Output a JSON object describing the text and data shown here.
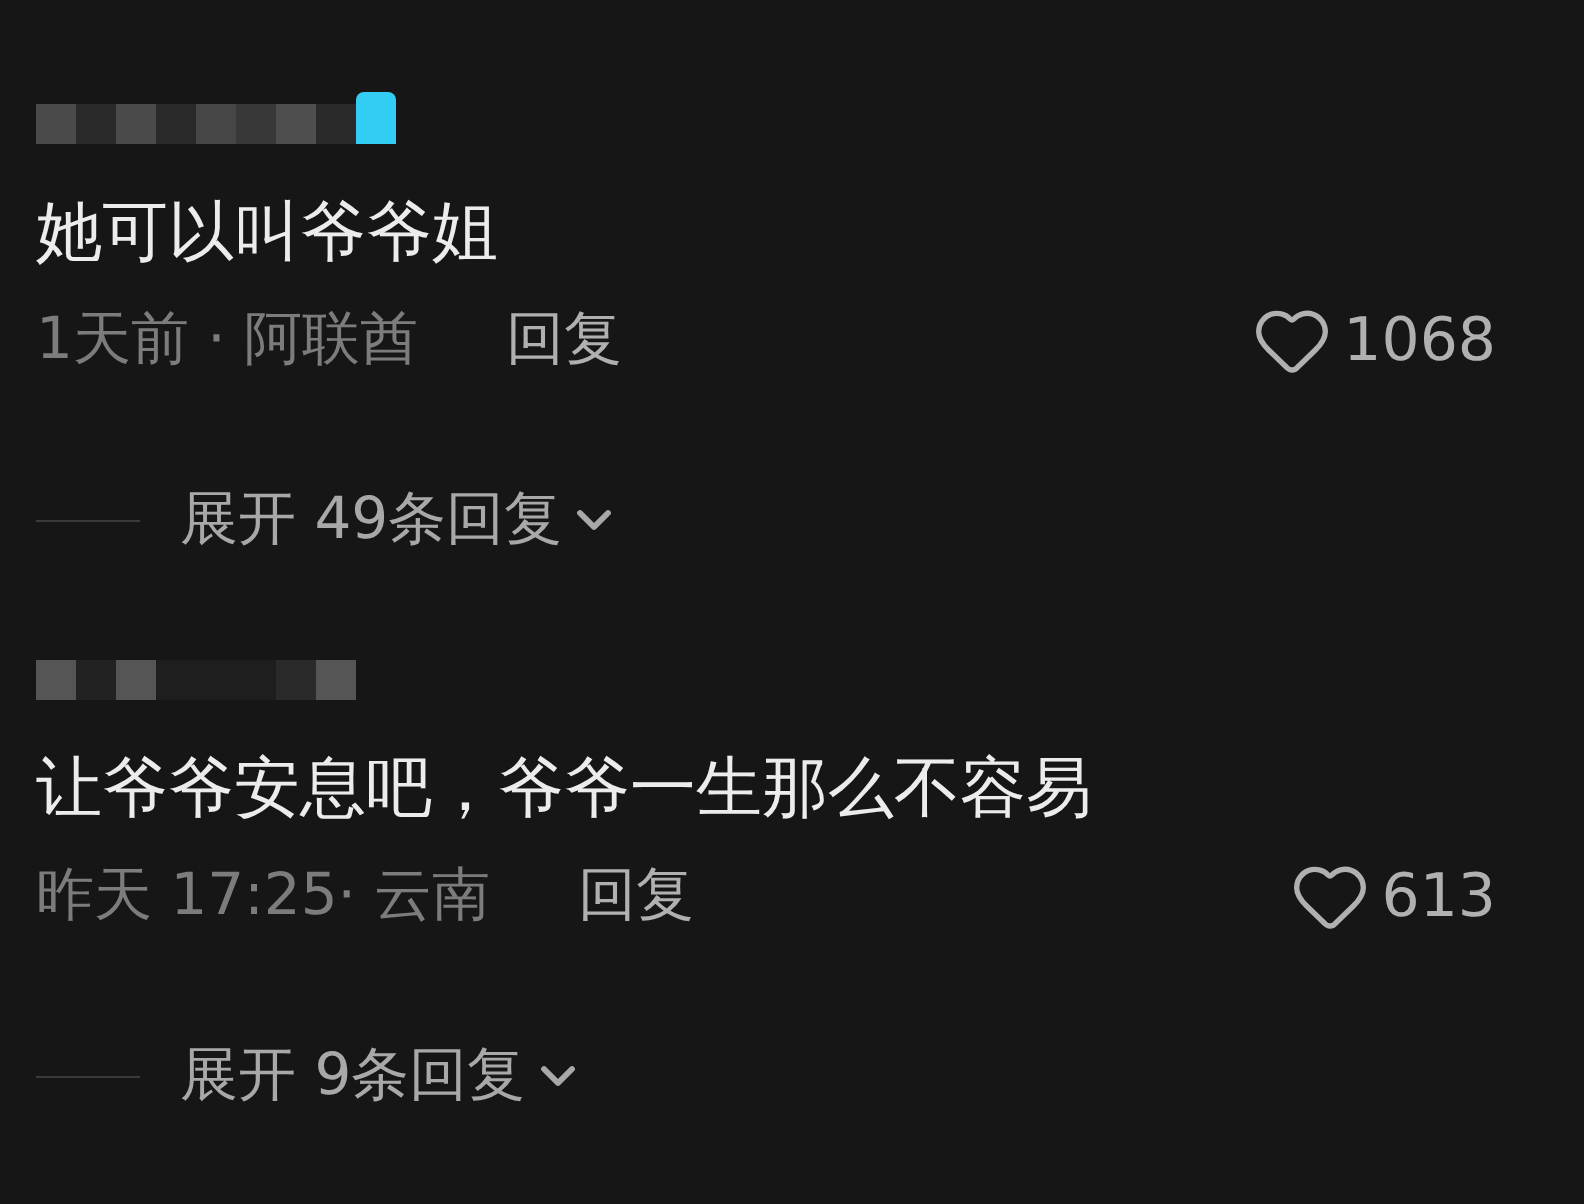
{
  "comments": [
    {
      "text": "她可以叫爷爷姐",
      "meta": "1天前 · 阿联酋",
      "reply": "回复",
      "likes": "1068",
      "expand": "展开 49条回复"
    },
    {
      "text": "让爷爷安息吧，爷爷一生那么不容易",
      "meta": "昨天 17:25· 云南",
      "reply": "回复",
      "likes": "613",
      "expand": "展开 9条回复"
    }
  ]
}
